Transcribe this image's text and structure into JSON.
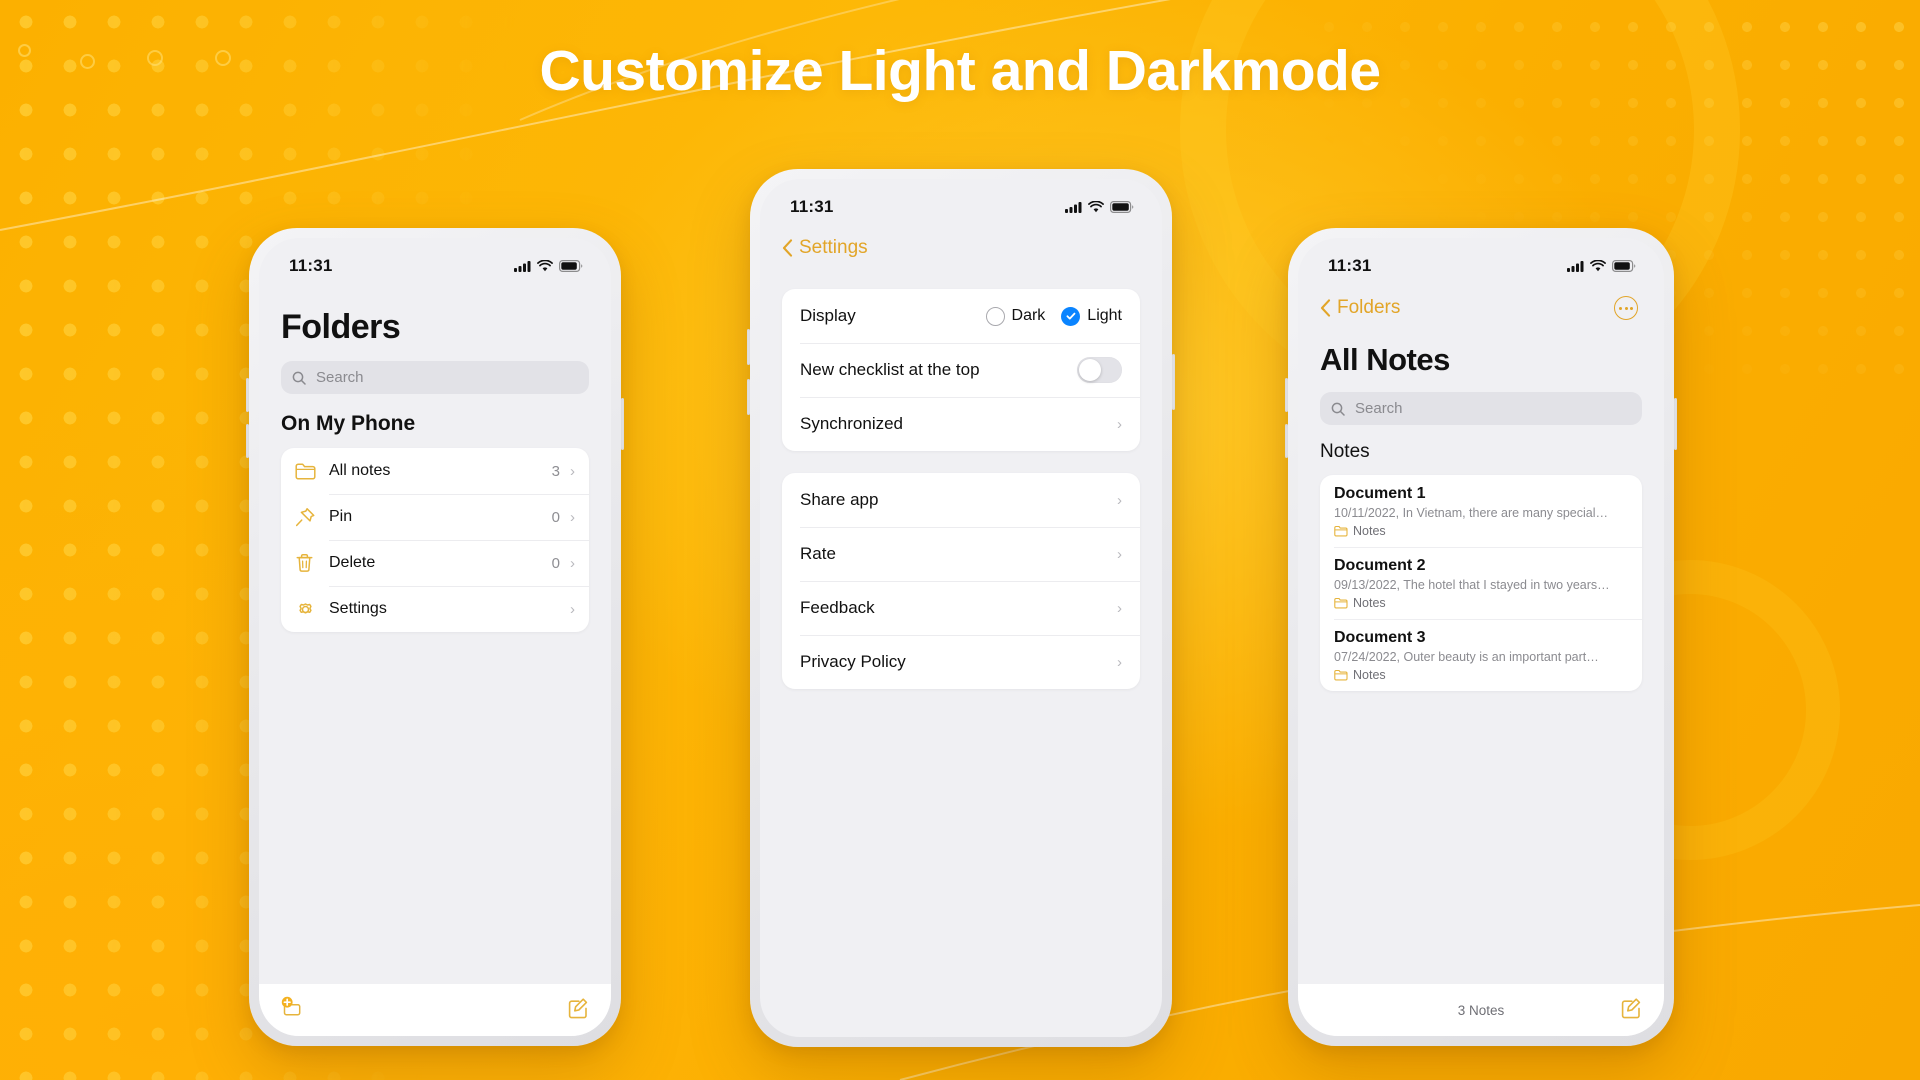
{
  "page": {
    "title": "Customize Light and Darkmode",
    "background_color": "#FBAF00",
    "accent_color": "#E2A528",
    "selected_color": "#0A84FF"
  },
  "phone_left": {
    "status": {
      "time": "11:31",
      "signal_icon": "signal-bars-icon",
      "wifi_icon": "wifi-icon",
      "battery_icon": "battery-icon"
    },
    "title": "Folders",
    "search": {
      "placeholder": "Search",
      "icon": "search-icon"
    },
    "section_label": "On My Phone",
    "items": [
      {
        "icon": "folder-icon",
        "label": "All notes",
        "count": "3",
        "chevron": "chevron-right-icon"
      },
      {
        "icon": "pin-icon",
        "label": "Pin",
        "count": "0",
        "chevron": "chevron-right-icon"
      },
      {
        "icon": "trash-icon",
        "label": "Delete",
        "count": "0",
        "chevron": "chevron-right-icon"
      },
      {
        "icon": "gear-icon",
        "label": "Settings",
        "count": "",
        "chevron": "chevron-right-icon"
      }
    ],
    "bottom": {
      "add_icon": "add-folder-icon",
      "compose_icon": "compose-icon"
    }
  },
  "phone_mid": {
    "status": {
      "time": "11:31",
      "signal_icon": "signal-bars-icon",
      "wifi_icon": "wifi-icon",
      "battery_icon": "battery-icon"
    },
    "back": {
      "label": "Settings",
      "icon": "chevron-left-icon"
    },
    "group_one": {
      "display": {
        "label": "Display",
        "options": [
          {
            "label": "Dark",
            "selected": false
          },
          {
            "label": "Light",
            "selected": true
          }
        ]
      },
      "checklist": {
        "label": "New checklist at the top",
        "toggle_on": false
      },
      "synchronized": {
        "label": "Synchronized",
        "chevron": "chevron-right-icon"
      }
    },
    "group_two": [
      {
        "label": "Share app",
        "chevron": "chevron-right-icon"
      },
      {
        "label": "Rate",
        "chevron": "chevron-right-icon"
      },
      {
        "label": "Feedback",
        "chevron": "chevron-right-icon"
      },
      {
        "label": "Privacy Policy",
        "chevron": "chevron-right-icon"
      }
    ]
  },
  "phone_right": {
    "status": {
      "time": "11:31",
      "signal_icon": "signal-bars-icon",
      "wifi_icon": "wifi-icon",
      "battery_icon": "battery-icon"
    },
    "back": {
      "label": "Folders",
      "icon": "chevron-left-icon"
    },
    "more_icon": "more-options-icon",
    "title": "All Notes",
    "search": {
      "placeholder": "Search",
      "icon": "search-icon"
    },
    "section_label": "Notes",
    "notes": [
      {
        "title": "Document 1",
        "subtitle": "10/11/2022, In Vietnam, there are many special…",
        "folder": "Notes",
        "folder_icon": "folder-icon"
      },
      {
        "title": "Document 2",
        "subtitle": "09/13/2022, The hotel that I stayed in two years…",
        "folder": "Notes",
        "folder_icon": "folder-icon"
      },
      {
        "title": "Document 3",
        "subtitle": "07/24/2022, Outer beauty is an important part…",
        "folder": "Notes",
        "folder_icon": "folder-icon"
      }
    ],
    "bottom": {
      "count_label": "3 Notes",
      "compose_icon": "compose-icon"
    }
  }
}
